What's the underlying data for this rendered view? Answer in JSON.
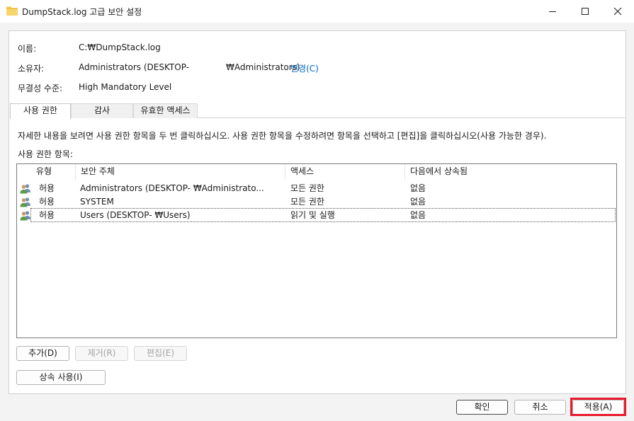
{
  "window": {
    "title": "DumpStack.log 고급 보안 설정"
  },
  "info": {
    "name_label": "이름:",
    "name_value": "C:₩DumpStack.log",
    "owner_label": "소유자:",
    "owner_value_prefix": "Administrators (DESKTOP-",
    "owner_value_suffix": "₩Administrators)",
    "owner_change_link": "변경(C)",
    "integrity_label": "무결성 수준:",
    "integrity_value": "High Mandatory Level"
  },
  "tabs": [
    {
      "label": "사용 권한",
      "active": true
    },
    {
      "label": "감사",
      "active": false
    },
    {
      "label": "유효한 액세스",
      "active": false
    }
  ],
  "permissions": {
    "description": "자세한 내용을 보려면 사용 권한 항목을 두 번 클릭하십시오. 사용 권한 항목을 수정하려면 항목을 선택하고 [편집]을 클릭하십시오(사용 가능한 경우).",
    "list_label": "사용 권한 항목:",
    "columns": [
      "유형",
      "보안 주체",
      "액세스",
      "다음에서 상속됨"
    ],
    "rows": [
      {
        "type": "허용",
        "principal": "Administrators (DESKTOP-        ₩Administrato...",
        "access": "모든 권한",
        "inherited": "없음"
      },
      {
        "type": "허용",
        "principal": "SYSTEM",
        "access": "모든 권한",
        "inherited": "없음"
      },
      {
        "type": "허용",
        "principal": "Users (DESKTOP-        ₩Users)",
        "access": "읽기 및 실행",
        "inherited": "없음"
      }
    ]
  },
  "buttons": {
    "add": "추가(D)",
    "remove": "제거(R)",
    "edit": "편집(E)",
    "inheritance": "상속 사용(I)",
    "ok": "확인",
    "cancel": "취소",
    "apply": "적용(A)"
  },
  "colors": {
    "link": "#0067c0",
    "highlight": "#e8192c"
  }
}
